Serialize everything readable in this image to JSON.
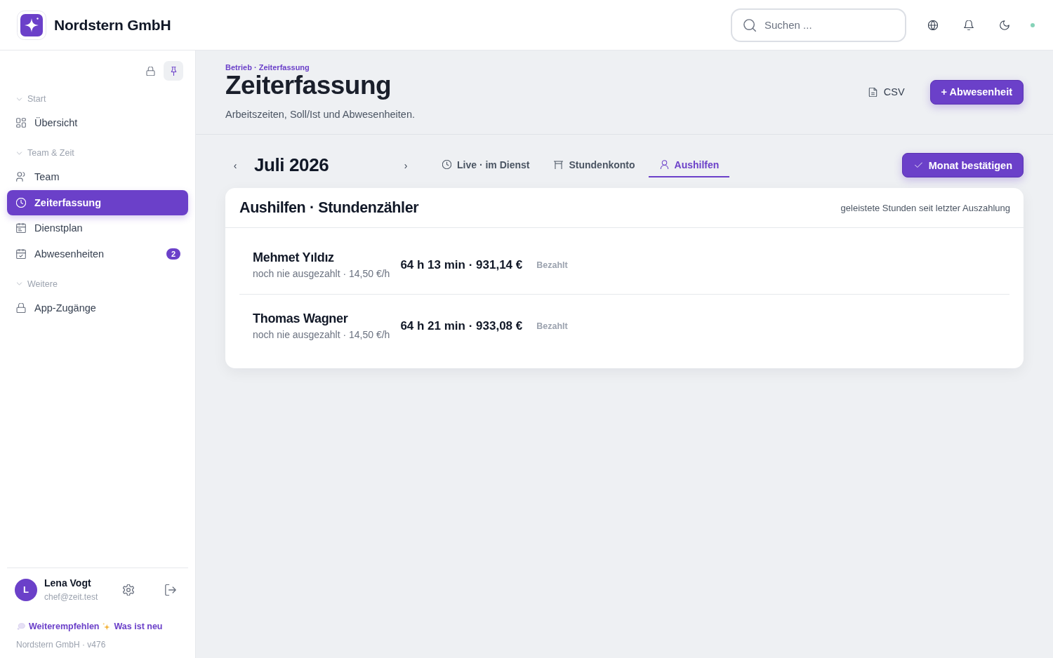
{
  "header": {
    "app_name": "Nordstern GmbH",
    "search": {
      "placeholder": "Suchen ..."
    }
  },
  "sidebar": {
    "pinned": true,
    "groups": [
      {
        "label": "Start",
        "expanded": true,
        "items": [
          {
            "label": "Übersicht",
            "selected": false
          }
        ]
      },
      {
        "label": "Team & Zeit",
        "expanded": true,
        "items": [
          {
            "label": "Team",
            "selected": false
          },
          {
            "label": "Zeiterfassung",
            "selected": true
          },
          {
            "label": "Dienstplan",
            "selected": false
          },
          {
            "label": "Abwesenheiten",
            "selected": false,
            "badge": "2"
          }
        ]
      },
      {
        "label": "Weitere",
        "expanded": true,
        "items": [
          {
            "label": "App-Zugänge",
            "selected": false
          }
        ]
      }
    ],
    "user": {
      "initial": "L",
      "name": "Lena Vogt",
      "email": "chef@zeit.test"
    },
    "links": [
      "Weiterempfehlen",
      "Was ist neu"
    ],
    "version": "Nordstern GmbH · v476"
  },
  "page": {
    "breadcrumb": "Betrieb · Zeiterfassung",
    "title": "Zeiterfassung",
    "subtitle": "Arbeitszeiten, Soll/Ist und Abwesenheiten.",
    "actions": [
      {
        "label": "CSV",
        "kind": "export"
      },
      {
        "label": "+ Abwesenheit",
        "kind": "primary"
      }
    ]
  },
  "month_nav": {
    "prev": "‹",
    "label": "Juli 2026",
    "next": "›"
  },
  "tabs": [
    {
      "label": "Live · im Dienst",
      "selected": false
    },
    {
      "label": "Stundenkonto",
      "selected": false
    },
    {
      "label": "Aushilfen",
      "selected": true
    }
  ],
  "confirm_button": "Monat bestätigen",
  "card": {
    "title": "Aushilfen · Stundenzähler",
    "hint": "geleistete Stunden seit letzter Auszahlung",
    "rows": [
      {
        "name": "Mehmet Yıldız",
        "detail": "noch nie ausgezahlt · 14,50 €/h",
        "total": "64 h 13 min · 931,14 €",
        "action": "Bezahlt"
      },
      {
        "name": "Thomas Wagner",
        "detail": "noch nie ausgezahlt · 14,50 €/h",
        "total": "64 h 21 min · 933,08 €",
        "action": "Bezahlt"
      }
    ]
  }
}
